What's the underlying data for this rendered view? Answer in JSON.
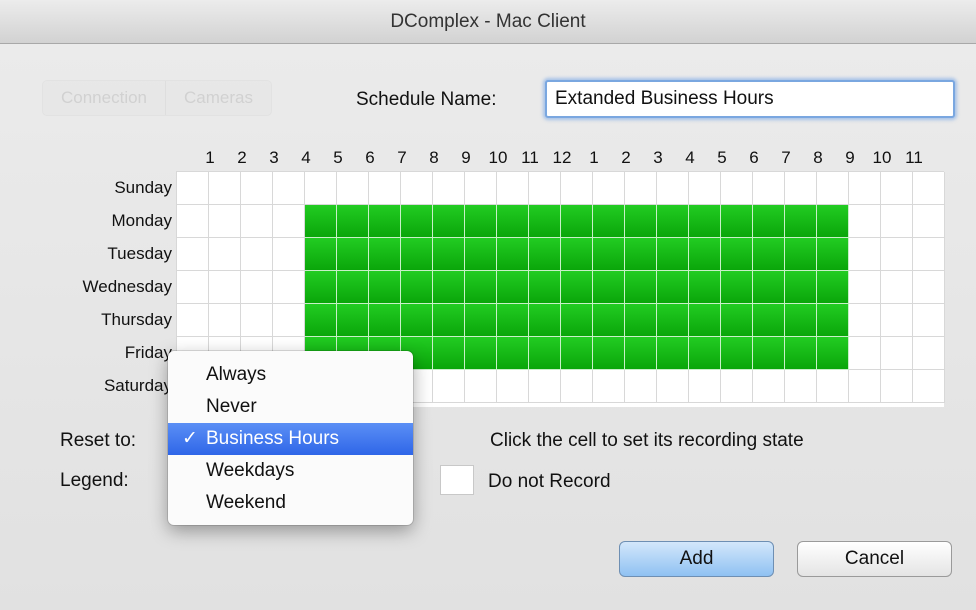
{
  "window": {
    "title": "DComplex - Mac Client"
  },
  "background_tabs": [
    "Connection",
    "Cameras"
  ],
  "schedule": {
    "label": "Schedule Name:",
    "value": "Extanded Business Hours"
  },
  "hours": [
    "1",
    "2",
    "3",
    "4",
    "5",
    "6",
    "7",
    "8",
    "9",
    "10",
    "11",
    "12",
    "1",
    "2",
    "3",
    "4",
    "5",
    "6",
    "7",
    "8",
    "9",
    "10",
    "11"
  ],
  "days": [
    "Sunday",
    "Monday",
    "Tuesday",
    "Wednesday",
    "Thursday",
    "Friday",
    "Saturday"
  ],
  "grid": {
    "columns": 24,
    "recording_rows": [
      1,
      2,
      3,
      4,
      5
    ],
    "recording_start_col": 4,
    "recording_end_col": 20
  },
  "reset": {
    "label": "Reset to:"
  },
  "legend": {
    "label": "Legend:",
    "do_not_record": "Do not Record"
  },
  "hint": "Click the cell to set its recording state",
  "menu": {
    "items": [
      "Always",
      "Never",
      "Business Hours",
      "Weekdays",
      "Weekend"
    ],
    "selected": "Business Hours",
    "check_glyph": "✓"
  },
  "buttons": {
    "add": "Add",
    "cancel": "Cancel"
  },
  "colors": {
    "recording": "#12b812",
    "selection": "#3b70ec",
    "focus": "#7aa7e0"
  }
}
